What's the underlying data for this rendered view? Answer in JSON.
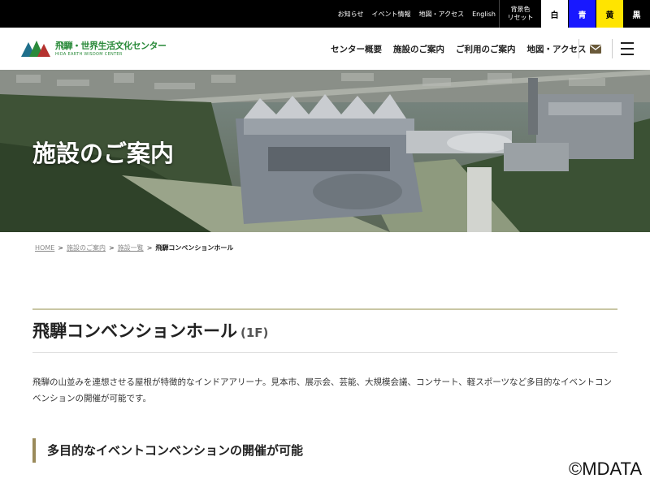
{
  "topbar": {
    "links": [
      "お知らせ",
      "イベント情報",
      "地図・アクセス",
      "English"
    ],
    "bg_reset_line1": "背景色",
    "bg_reset_line2": "リセット",
    "swatches": [
      "白",
      "青",
      "黄",
      "黒"
    ]
  },
  "header": {
    "logo_name": "飛騨・世界生活文化センター",
    "logo_sub": "HIDA EARTH WISDOM CENTER",
    "nav": [
      "センター概要",
      "施設のご案内",
      "ご利用のご案内",
      "地図・アクセス"
    ]
  },
  "hero": {
    "title": "施設のご案内"
  },
  "breadcrumb": {
    "items": [
      "HOME",
      "施設のご案内",
      "施設一覧"
    ],
    "separator": ">",
    "current": "飛騨コンベンションホール"
  },
  "main": {
    "title": "飛騨コンベンションホール",
    "floor": "(1F)",
    "description": "飛騨の山並みを連想させる屋根が特徴的なインドアアリーナ。見本市、展示会、芸能、大規模会議、コンサート、軽スポーツなど多目的なイベントコンベンションの開催が可能です。",
    "subheading": "多目的なイベントコンベンションの開催が可能"
  },
  "watermark": "©MDATA",
  "colors": {
    "accent_rule": "#c9c6a4",
    "subhead_bar": "#9a8a5a",
    "logo_green": "#2a8a3a",
    "swatch_blue": "#1818ff",
    "swatch_yellow": "#ffe400"
  }
}
